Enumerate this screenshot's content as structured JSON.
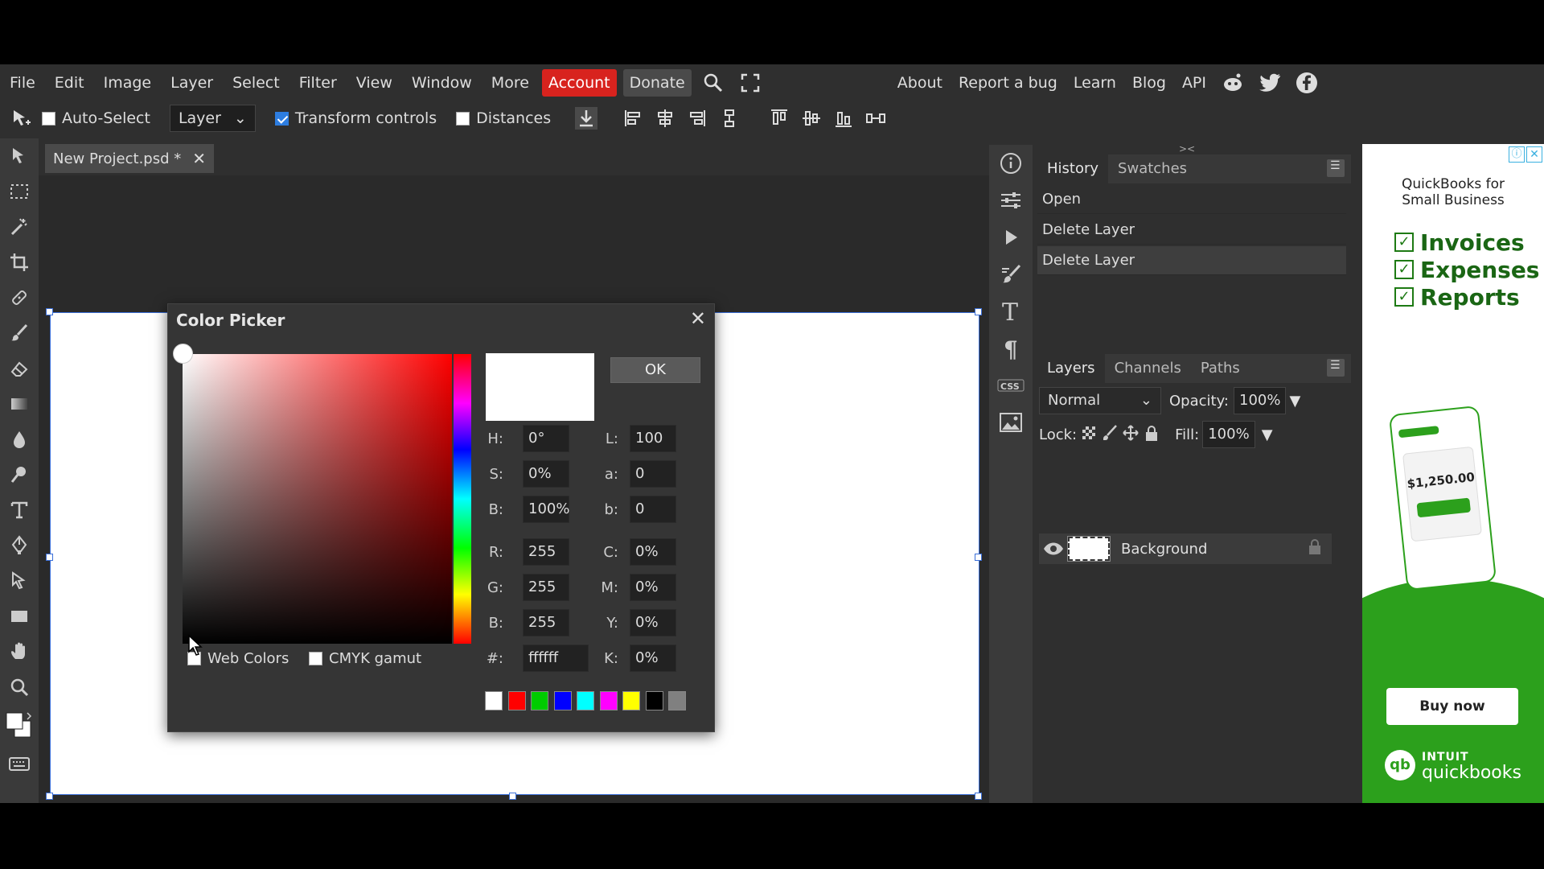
{
  "menu": {
    "items": [
      "File",
      "Edit",
      "Image",
      "Layer",
      "Select",
      "Filter",
      "View",
      "Window",
      "More"
    ],
    "account": "Account",
    "donate": "Donate",
    "right": [
      "About",
      "Report a bug",
      "Learn",
      "Blog",
      "API"
    ]
  },
  "options": {
    "auto_select": "Auto-Select",
    "layer_select": "Layer",
    "transform_controls": "Transform controls",
    "distances": "Distances"
  },
  "doc": {
    "tab_name": "New Project.psd *"
  },
  "history": {
    "tabs": [
      "History",
      "Swatches"
    ],
    "items": [
      "Open",
      "Delete Layer",
      "Delete Layer"
    ]
  },
  "layers": {
    "tabs": [
      "Layers",
      "Channels",
      "Paths"
    ],
    "blend_mode": "Normal",
    "opacity_label": "Opacity:",
    "opacity_value": "100%",
    "lock_label": "Lock:",
    "fill_label": "Fill:",
    "fill_value": "100%",
    "layer_name": "Background"
  },
  "picker": {
    "title": "Color Picker",
    "ok": "OK",
    "fields": {
      "H": "0°",
      "S": "0%",
      "B": "100%",
      "R": "255",
      "G": "255",
      "B2": "255",
      "hex": "ffffff",
      "L": "100",
      "a": "0",
      "b": "0",
      "C": "0%",
      "M": "0%",
      "Y": "0%",
      "K": "0%"
    },
    "labels": {
      "H": "H:",
      "S": "S:",
      "B": "B:",
      "R": "R:",
      "G": "G:",
      "B2": "B:",
      "hex": "#:",
      "L": "L:",
      "a": "a:",
      "b": "b:",
      "C": "C:",
      "M": "M:",
      "Y": "Y:",
      "K": "K:"
    },
    "web_colors": "Web Colors",
    "cmyk_gamut": "CMYK gamut",
    "swatches": [
      "#ffffff",
      "#ff0000",
      "#00cc00",
      "#0000ff",
      "#00ffff",
      "#ff00ff",
      "#ffff00",
      "#000000",
      "#808080"
    ]
  },
  "ad": {
    "heading1": "QuickBooks for",
    "heading2": "Small Business",
    "items": [
      "Invoices",
      "Expenses",
      "Reports"
    ],
    "amount": "$1,250.00",
    "buy_now": "Buy now",
    "brand1": "INTUIT",
    "brand2": "quickbooks"
  }
}
